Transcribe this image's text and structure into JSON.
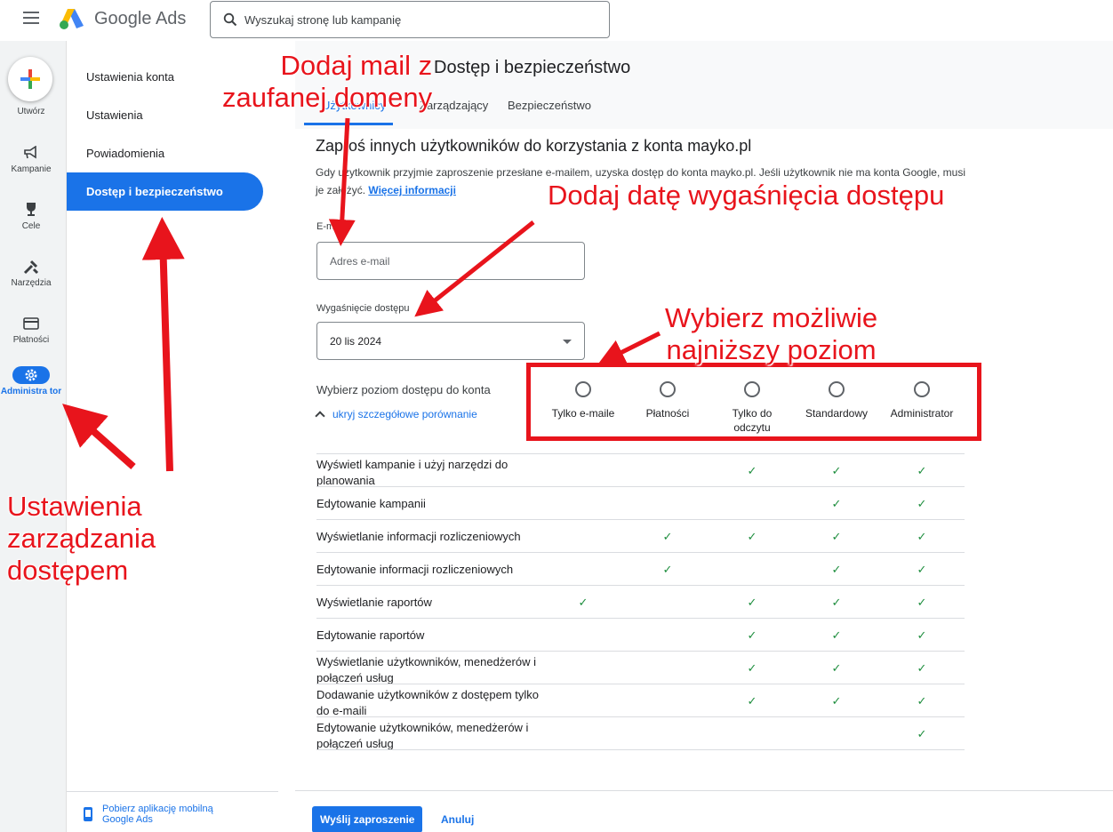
{
  "topbar": {
    "app_title": "Google Ads",
    "search_placeholder": "Wyszukaj stronę lub kampanię"
  },
  "rail": {
    "create_label": "Utwórz",
    "items": [
      {
        "label": "Kampanie",
        "icon": "megaphone-icon"
      },
      {
        "label": "Cele",
        "icon": "trophy-icon"
      },
      {
        "label": "Narzędzia",
        "icon": "tools-icon"
      },
      {
        "label": "Płatności",
        "icon": "credit-card-icon"
      },
      {
        "label": "Administra tor",
        "icon": "gear-icon",
        "active": true
      }
    ]
  },
  "subnav": {
    "items": [
      {
        "label": "Ustawienia konta"
      },
      {
        "label": "Ustawienia"
      },
      {
        "label": "Powiadomienia"
      },
      {
        "label": "Dostęp i bezpieczeństwo",
        "active": true
      }
    ],
    "mobile_app_link": "Pobierz aplikację mobilną Google Ads"
  },
  "header": {
    "title": "Dostęp i bezpieczeństwo",
    "tabs": [
      {
        "label": "Użytkownicy",
        "active": true
      },
      {
        "label": "Zarządzający"
      },
      {
        "label": "Bezpieczeństwo"
      }
    ]
  },
  "invite": {
    "title": "Zaproś innych użytkowników do korzystania z konta mayko.pl",
    "desc_text": "Gdy użytkownik przyjmie zaproszenie przesłane e-mailem, uzyska dostęp do konta mayko.pl. Jeśli użytkownik nie ma konta Google, musi je założyć.",
    "desc_link": "Więcej informacji",
    "email_label": "E-mail",
    "email_placeholder": "Adres e-mail",
    "expiry_label": "Wygaśnięcie dostępu",
    "expiry_value": "20 lis 2024",
    "level_label": "Wybierz poziom dostępu do konta",
    "toggle_label": "ukryj szczegółowe porównanie",
    "levels": [
      "Tylko e-maile",
      "Płatności",
      "Tylko do odczytu",
      "Standardowy",
      "Administrator"
    ],
    "check_glyph": "✓",
    "rows": [
      {
        "label": "Wyświetl kampanie i użyj narzędzi do planowania",
        "checks": [
          false,
          false,
          true,
          true,
          true
        ]
      },
      {
        "label": "Edytowanie kampanii",
        "checks": [
          false,
          false,
          false,
          true,
          true
        ]
      },
      {
        "label": "Wyświetlanie informacji rozliczeniowych",
        "checks": [
          false,
          true,
          true,
          true,
          true
        ]
      },
      {
        "label": "Edytowanie informacji rozliczeniowych",
        "checks": [
          false,
          true,
          false,
          true,
          true
        ]
      },
      {
        "label": "Wyświetlanie raportów",
        "checks": [
          true,
          false,
          true,
          true,
          true
        ]
      },
      {
        "label": "Edytowanie raportów",
        "checks": [
          false,
          false,
          true,
          true,
          true
        ]
      },
      {
        "label": "Wyświetlanie użytkowników, menedżerów i połączeń usług",
        "checks": [
          false,
          false,
          true,
          true,
          true
        ]
      },
      {
        "label": "Dodawanie użytkowników z dostępem tylko do e-maili",
        "checks": [
          false,
          false,
          true,
          true,
          true
        ]
      },
      {
        "label": "Edytowanie użytkowników, menedżerów i połączeń usług",
        "checks": [
          false,
          false,
          false,
          false,
          true
        ]
      }
    ]
  },
  "footer": {
    "submit_label": "Wyślij zaproszenie",
    "cancel_label": "Anuluj"
  },
  "annotations": {
    "email_note": "Dodaj mail z\nzaufanej domeny",
    "expiry_note": "Dodaj datę wygaśnięcia dostępu",
    "level_note": "Wybierz możliwie\nnajniższy poziom",
    "settings_note": "Ustawienia\nzarządzania\ndostępem",
    "color": "#e8141c"
  },
  "colors": {
    "accent": "#1a73e8",
    "check": "#1e8e3e",
    "annotation": "#e8141c"
  }
}
